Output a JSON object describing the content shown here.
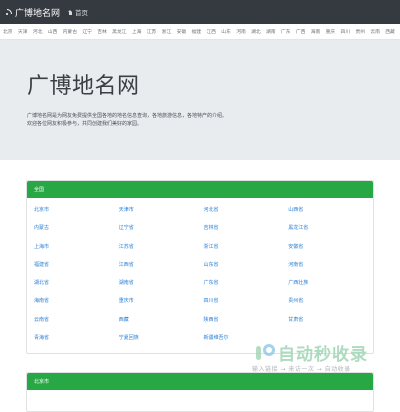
{
  "navbar": {
    "brand": "广博地名网",
    "home": "首页"
  },
  "province_nav": [
    "北京",
    "天津",
    "河北",
    "山西",
    "内蒙古",
    "辽宁",
    "吉林",
    "黑龙江",
    "上海",
    "江苏",
    "浙江",
    "安徽",
    "福建",
    "江西",
    "山东",
    "河南",
    "湖北",
    "湖南",
    "广东",
    "广西",
    "海南",
    "重庆",
    "四川",
    "贵州",
    "云南",
    "西藏",
    "陕西",
    "甘肃",
    "青海"
  ],
  "hero": {
    "title": "广博地名网",
    "line1": "广博地名网是为网友免费提供全国各地的地名信息查询，各地旅游信息，各地特产的介绍。",
    "line2": "欢迎各位网友积极参与，共同创建我们美好的家园。"
  },
  "card1": {
    "header": "全国",
    "provinces": [
      "北京市",
      "天津市",
      "河北省",
      "山西省",
      "内蒙古",
      "辽宁省",
      "吉林省",
      "黑龙江省",
      "上海市",
      "江苏省",
      "浙江省",
      "安徽省",
      "福建省",
      "江西省",
      "山东省",
      "河南省",
      "湖北省",
      "湖南省",
      "广东省",
      "广西壮族",
      "海南省",
      "重庆市",
      "四川省",
      "贵州省",
      "云南省",
      "西藏",
      "陕西省",
      "甘肃省",
      "青海省",
      "宁夏回族",
      "新疆维吾尔"
    ]
  },
  "card2": {
    "header": "北京市"
  },
  "watermark": {
    "text": "自动秒收录",
    "sub": "输入链接 → 来访一次 → 自动收录"
  },
  "colors": {
    "navbar": "#343a40",
    "card_header": "#28a745",
    "link": "#2a7fd4",
    "jumbotron": "#e9ecef"
  }
}
